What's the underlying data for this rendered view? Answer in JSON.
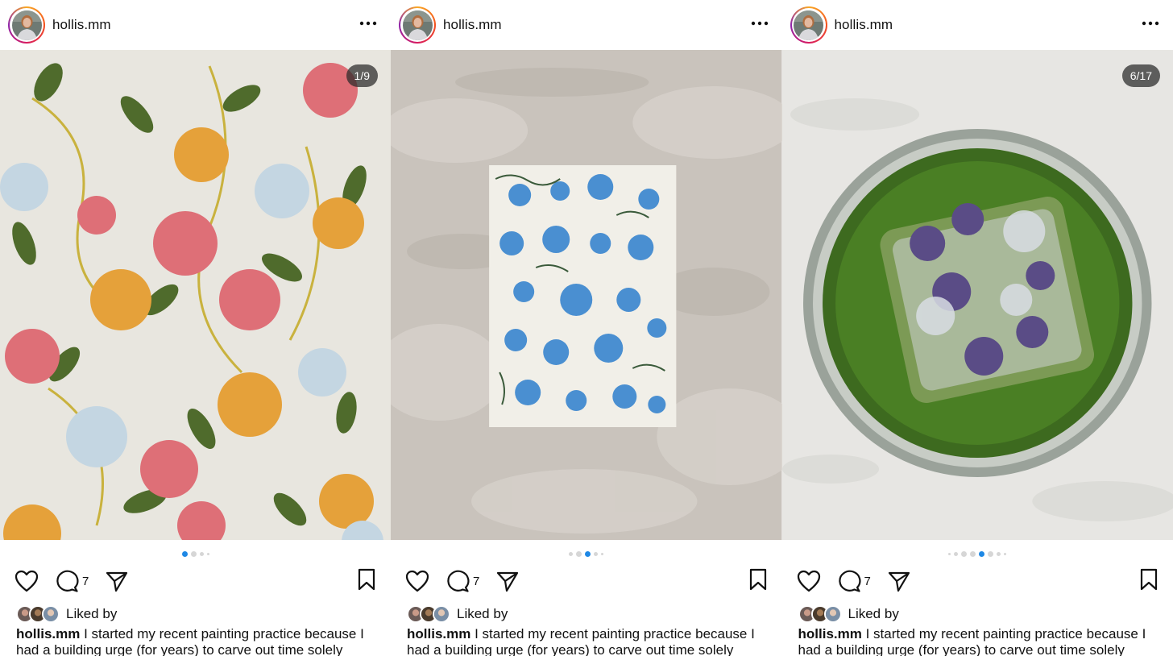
{
  "posts": [
    {
      "username": "hollis.mm",
      "counter": "1/9",
      "comment_count": "7",
      "liked_by": "Liked by",
      "caption": "I started my recent painting practice because I had a building urge (for years) to carve out time solely"
    },
    {
      "username": "hollis.mm",
      "counter": "",
      "comment_count": "7",
      "liked_by": "Liked by",
      "caption": "I started my recent painting practice because I had a building urge (for years) to carve out time solely"
    },
    {
      "username": "hollis.mm",
      "counter": "6/17",
      "comment_count": "7",
      "liked_by": "Liked by",
      "caption": "I started my recent painting practice because I had a building urge (for years) to carve out time solely"
    }
  ],
  "icons": {
    "more": "more-options-icon",
    "like": "heart-icon",
    "comment": "comment-icon",
    "share": "send-icon",
    "save": "bookmark-icon"
  },
  "carousel": {
    "post1_active_index": 0,
    "post2_active_index": 2,
    "post3_active_index": 5
  },
  "colors": {
    "accent": "#1e88e5",
    "counter_bg": "#3a3a3a"
  }
}
